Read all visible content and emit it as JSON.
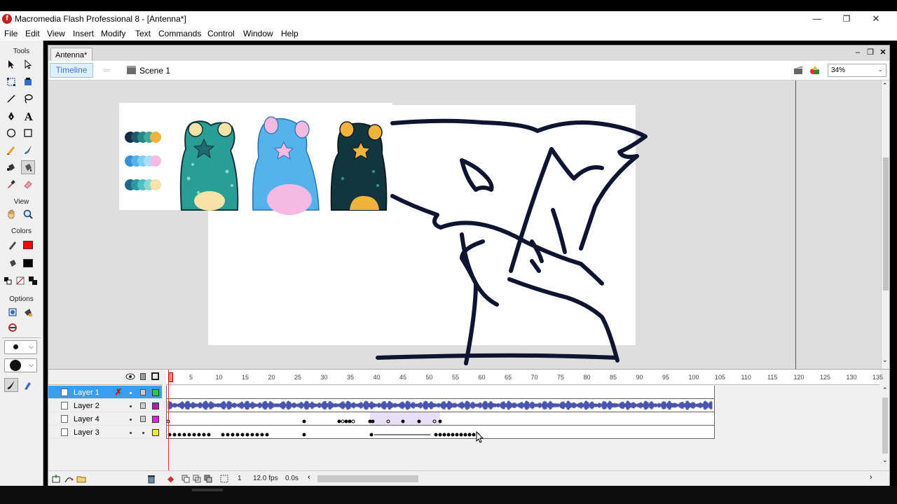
{
  "window": {
    "title": "Macromedia Flash Professional 8 - [Antenna*]",
    "app_icon_glyph": "f"
  },
  "menu": [
    "File",
    "Edit",
    "View",
    "Insert",
    "Modify",
    "Text",
    "Commands",
    "Control",
    "Window",
    "Help"
  ],
  "toolbox": {
    "tools_title": "Tools",
    "view_title": "View",
    "colors_title": "Colors",
    "options_title": "Options",
    "stroke_color": "#ff0000",
    "fill_color": "#000000"
  },
  "document": {
    "tab_title": "Antenna*",
    "timeline_button": "Timeline",
    "scene_label": "Scene 1",
    "zoom": "34%"
  },
  "palette": {
    "rows": [
      [
        "#152c44",
        "#1d5a6c",
        "#248a88",
        "#3fa89a",
        "#f2b33d"
      ],
      [
        "#3b8fd4",
        "#53b3ea",
        "#7dd0f3",
        "#a8e0fa",
        "#f5b9e2"
      ],
      [
        "#236a84",
        "#2d97a6",
        "#4fc0c2",
        "#8ad8d6",
        "#f7e3a8"
      ]
    ]
  },
  "layers": [
    {
      "name": "Layer 1",
      "selected": true,
      "color": "#22cc44"
    },
    {
      "name": "Layer 2",
      "selected": false,
      "color": "#aa22aa"
    },
    {
      "name": "Layer 4",
      "selected": false,
      "color": "#dd22dd"
    },
    {
      "name": "Layer 3",
      "selected": false,
      "color": "#eeee22"
    }
  ],
  "ruler_ticks": [
    "5",
    "10",
    "15",
    "20",
    "25",
    "30",
    "35",
    "40",
    "45",
    "50",
    "55",
    "60",
    "65",
    "70",
    "75",
    "80",
    "85",
    "90",
    "95",
    "100",
    "105",
    "110",
    "115",
    "120",
    "125",
    "130",
    "135"
  ],
  "timeline_status": {
    "current_frame": "1",
    "fps": "12.0 fps",
    "time": "0.0s"
  }
}
